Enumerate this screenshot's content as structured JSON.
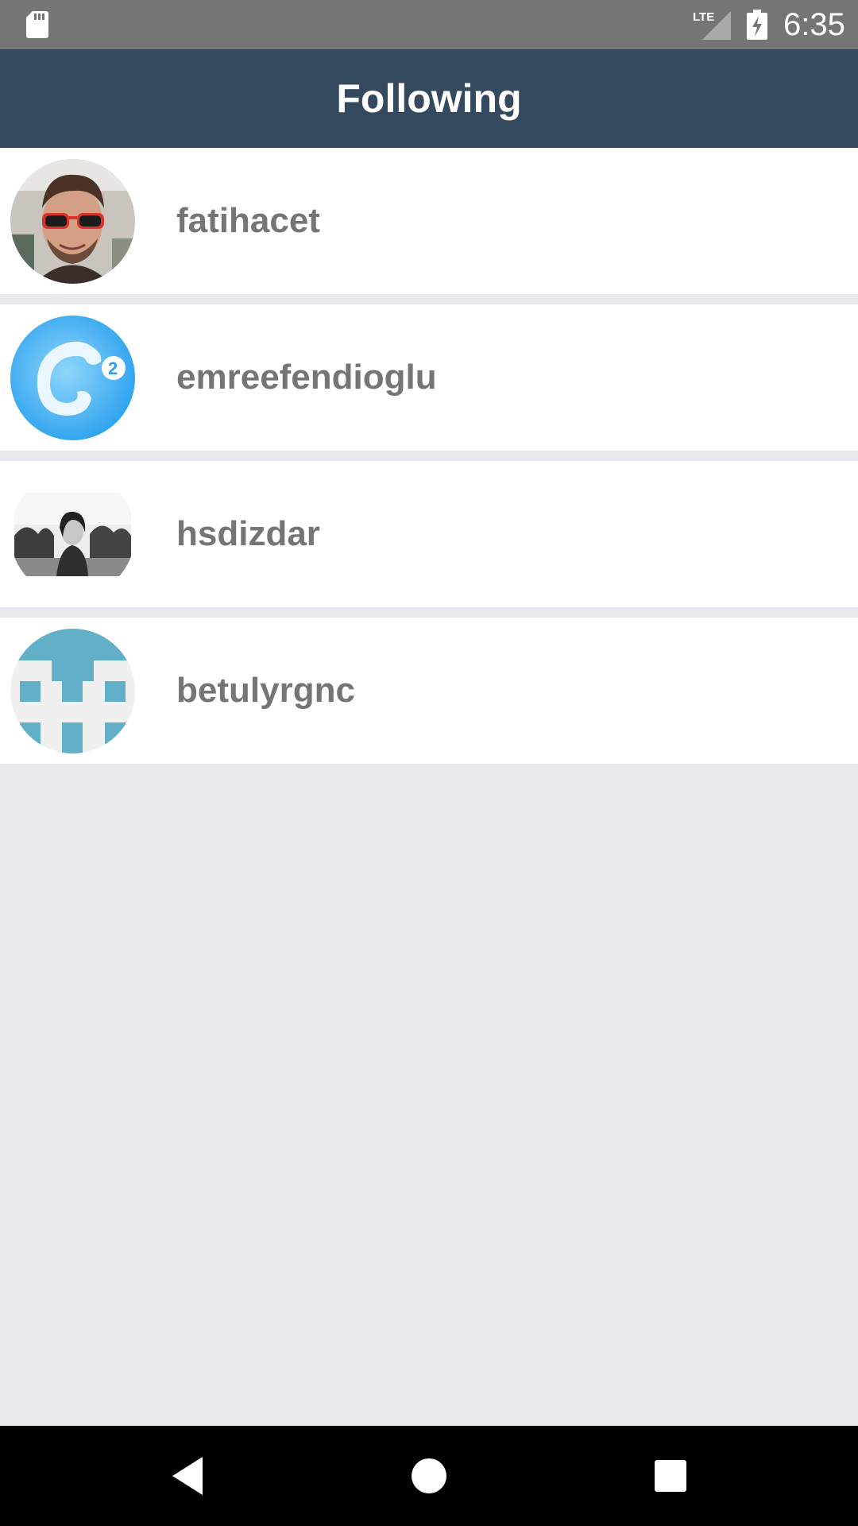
{
  "status_bar": {
    "time": "6:35",
    "network_label": "LTE",
    "icons": [
      "sd-card-icon",
      "lte-signal-icon",
      "battery-charging-icon"
    ]
  },
  "app_bar": {
    "title": "Following"
  },
  "following": [
    {
      "username": "fatihacet",
      "avatar": "photo-man-red-sunglasses"
    },
    {
      "username": "emreefendioglu",
      "avatar": "blue-circle-logo"
    },
    {
      "username": "hsdizdar",
      "avatar": "grayscale-photo-woman"
    },
    {
      "username": "betulyrgnc",
      "avatar": "identicon-blue-pattern"
    }
  ],
  "nav_bar": {
    "icons": [
      "back-icon",
      "home-icon",
      "recents-icon"
    ]
  },
  "colors": {
    "app_bar": "#34495e",
    "status_bar": "#757575",
    "background": "#e9e8ee",
    "username_text": "#757575",
    "identicon": "#62afc8"
  }
}
